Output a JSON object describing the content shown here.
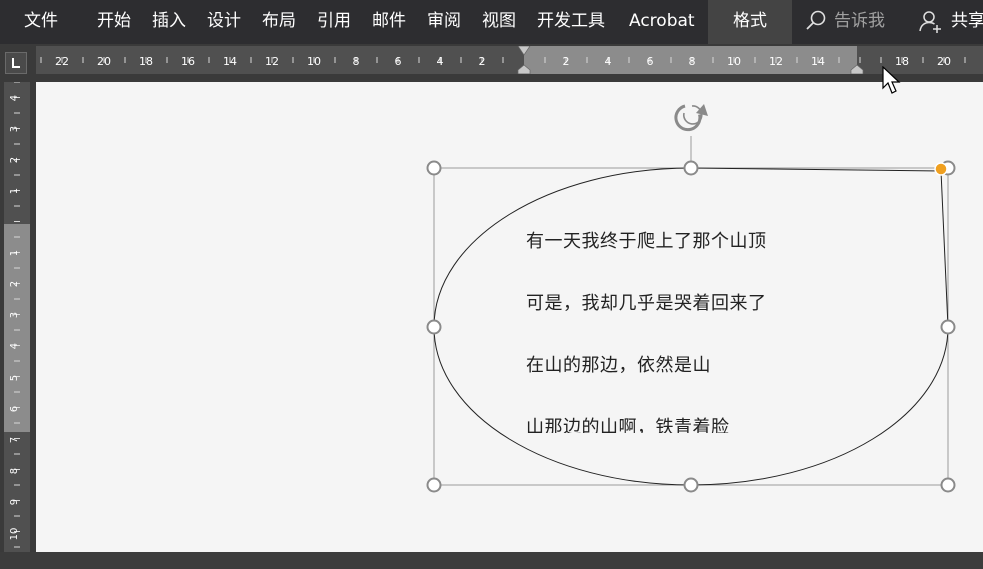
{
  "ribbon": {
    "tabs": [
      {
        "id": "file",
        "label": "文件"
      },
      {
        "id": "home",
        "label": "开始"
      },
      {
        "id": "insert",
        "label": "插入"
      },
      {
        "id": "design",
        "label": "设计"
      },
      {
        "id": "layout",
        "label": "布局"
      },
      {
        "id": "references",
        "label": "引用"
      },
      {
        "id": "mailings",
        "label": "邮件"
      },
      {
        "id": "review",
        "label": "审阅"
      },
      {
        "id": "view",
        "label": "视图"
      },
      {
        "id": "developer",
        "label": "开发工具"
      },
      {
        "id": "acrobat",
        "label": "Acrobat"
      }
    ],
    "active_tab": "格式",
    "tell_me": "告诉我",
    "share": "共享"
  },
  "ruler": {
    "horizontal_labels": [
      "22",
      "20",
      "18",
      "16",
      "14",
      "12",
      "10",
      "8",
      "6",
      "4",
      "2",
      "2",
      "4",
      "6",
      "8",
      "10",
      "12",
      "14",
      "18",
      "20"
    ],
    "vertical_labels": [
      "4",
      "3",
      "2",
      "1",
      "1",
      "2",
      "3",
      "4",
      "5",
      "6",
      "7",
      "8",
      "9",
      "10"
    ]
  },
  "document": {
    "shape_text": [
      "有一天我终于爬上了那个山顶",
      "可是，我却几乎是哭着回来了",
      "在山的那边，依然是山",
      "山那边的山啊，铁青着脸"
    ]
  },
  "colors": {
    "ribbon_bg": "#2d2d30",
    "active_tab_bg": "#444444",
    "ruler_bg": "#3a3a3a",
    "page_bg": "#f5f5f5",
    "adjust_handle": "#f0a020"
  }
}
